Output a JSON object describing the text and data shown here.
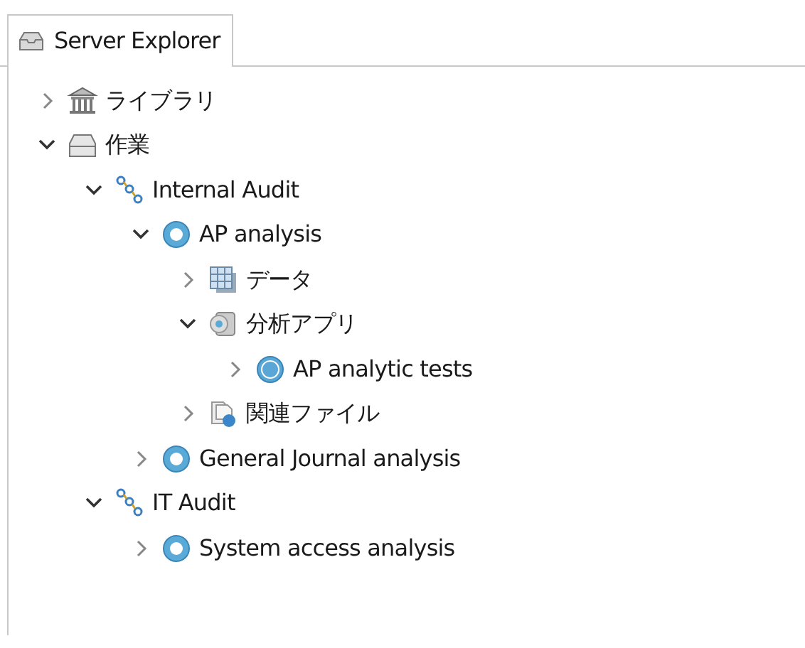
{
  "tab": {
    "label": "Server Explorer",
    "selected": true
  },
  "tree": [
    {
      "label": "ライブラリ",
      "kind": "library",
      "expanded": false
    },
    {
      "label": "作業",
      "kind": "drawer",
      "expanded": true,
      "children": [
        {
          "label": "Internal Audit",
          "kind": "project",
          "expanded": true,
          "children": [
            {
              "label": "AP analysis",
              "kind": "analysis",
              "expanded": true,
              "children": [
                {
                  "label": "データ",
                  "kind": "data",
                  "expanded": false
                },
                {
                  "label": "分析アプリ",
                  "kind": "app",
                  "expanded": true,
                  "children": [
                    {
                      "label": "AP analytic tests",
                      "kind": "acl",
                      "expanded": false
                    }
                  ]
                },
                {
                  "label": "関連ファイル",
                  "kind": "files",
                  "expanded": false
                }
              ]
            },
            {
              "label": "General Journal analysis",
              "kind": "analysis",
              "expanded": false
            }
          ]
        },
        {
          "label": "IT Audit",
          "kind": "project",
          "expanded": true,
          "children": [
            {
              "label": "System access analysis",
              "kind": "analysis",
              "expanded": false
            }
          ]
        }
      ]
    }
  ]
}
